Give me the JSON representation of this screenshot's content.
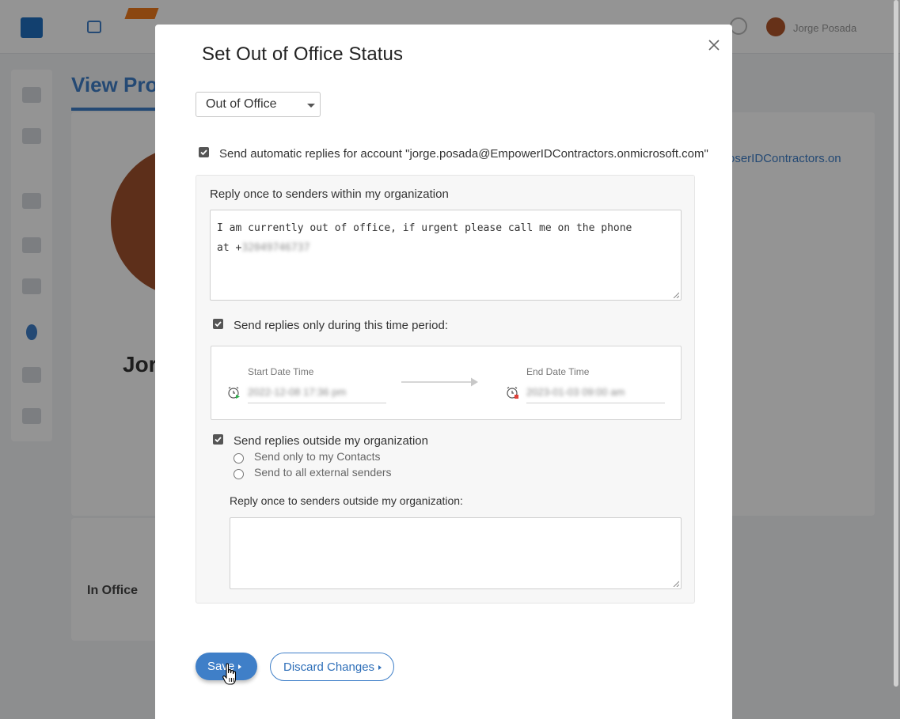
{
  "background": {
    "user_name": "Jorge Posada",
    "page_tab": "View Pro",
    "profile_name": "Jor",
    "email_link": "oserIDContractors.on",
    "status_text": "In Office"
  },
  "modal": {
    "title": "Set Out of Office Status",
    "status_select": {
      "selected": "Out of Office"
    },
    "auto_reply": {
      "checked": true,
      "label": "Send automatic replies for account \"jorge.posada@EmpowerIDContractors.onmicrosoft.com\""
    },
    "internal": {
      "label": "Reply once to senders within my organization",
      "message": "I am currently out of office, if urgent please call me on the phone at +",
      "message_redacted": "32049746737"
    },
    "time_period": {
      "checked": true,
      "label": "Send replies only during this time period:",
      "start_label": "Start Date Time",
      "start_value": "2022-12-08 17:36 pm",
      "end_label": "End Date Time",
      "end_value": "2023-01-03 09:00 am"
    },
    "external": {
      "checked": true,
      "label": "Send replies outside my organization",
      "options": [
        "Send only to my Contacts",
        "Send to all external senders"
      ],
      "reply_label": "Reply once to senders outside my organization:",
      "message": ""
    },
    "buttons": {
      "save": "Save",
      "discard": "Discard Changes"
    }
  },
  "colors": {
    "accent": "#3f7fc8",
    "checkbox": "#555555"
  }
}
